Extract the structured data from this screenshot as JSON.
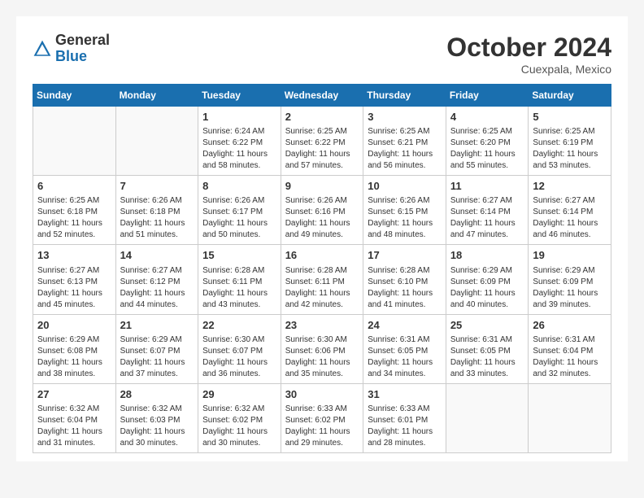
{
  "header": {
    "logo_line1": "General",
    "logo_line2": "Blue",
    "title": "October 2024",
    "subtitle": "Cuexpala, Mexico"
  },
  "days_of_week": [
    "Sunday",
    "Monday",
    "Tuesday",
    "Wednesday",
    "Thursday",
    "Friday",
    "Saturday"
  ],
  "weeks": [
    [
      {
        "day": "",
        "info": ""
      },
      {
        "day": "",
        "info": ""
      },
      {
        "day": "1",
        "info": "Sunrise: 6:24 AM\nSunset: 6:22 PM\nDaylight: 11 hours and 58 minutes."
      },
      {
        "day": "2",
        "info": "Sunrise: 6:25 AM\nSunset: 6:22 PM\nDaylight: 11 hours and 57 minutes."
      },
      {
        "day": "3",
        "info": "Sunrise: 6:25 AM\nSunset: 6:21 PM\nDaylight: 11 hours and 56 minutes."
      },
      {
        "day": "4",
        "info": "Sunrise: 6:25 AM\nSunset: 6:20 PM\nDaylight: 11 hours and 55 minutes."
      },
      {
        "day": "5",
        "info": "Sunrise: 6:25 AM\nSunset: 6:19 PM\nDaylight: 11 hours and 53 minutes."
      }
    ],
    [
      {
        "day": "6",
        "info": "Sunrise: 6:25 AM\nSunset: 6:18 PM\nDaylight: 11 hours and 52 minutes."
      },
      {
        "day": "7",
        "info": "Sunrise: 6:26 AM\nSunset: 6:18 PM\nDaylight: 11 hours and 51 minutes."
      },
      {
        "day": "8",
        "info": "Sunrise: 6:26 AM\nSunset: 6:17 PM\nDaylight: 11 hours and 50 minutes."
      },
      {
        "day": "9",
        "info": "Sunrise: 6:26 AM\nSunset: 6:16 PM\nDaylight: 11 hours and 49 minutes."
      },
      {
        "day": "10",
        "info": "Sunrise: 6:26 AM\nSunset: 6:15 PM\nDaylight: 11 hours and 48 minutes."
      },
      {
        "day": "11",
        "info": "Sunrise: 6:27 AM\nSunset: 6:14 PM\nDaylight: 11 hours and 47 minutes."
      },
      {
        "day": "12",
        "info": "Sunrise: 6:27 AM\nSunset: 6:14 PM\nDaylight: 11 hours and 46 minutes."
      }
    ],
    [
      {
        "day": "13",
        "info": "Sunrise: 6:27 AM\nSunset: 6:13 PM\nDaylight: 11 hours and 45 minutes."
      },
      {
        "day": "14",
        "info": "Sunrise: 6:27 AM\nSunset: 6:12 PM\nDaylight: 11 hours and 44 minutes."
      },
      {
        "day": "15",
        "info": "Sunrise: 6:28 AM\nSunset: 6:11 PM\nDaylight: 11 hours and 43 minutes."
      },
      {
        "day": "16",
        "info": "Sunrise: 6:28 AM\nSunset: 6:11 PM\nDaylight: 11 hours and 42 minutes."
      },
      {
        "day": "17",
        "info": "Sunrise: 6:28 AM\nSunset: 6:10 PM\nDaylight: 11 hours and 41 minutes."
      },
      {
        "day": "18",
        "info": "Sunrise: 6:29 AM\nSunset: 6:09 PM\nDaylight: 11 hours and 40 minutes."
      },
      {
        "day": "19",
        "info": "Sunrise: 6:29 AM\nSunset: 6:09 PM\nDaylight: 11 hours and 39 minutes."
      }
    ],
    [
      {
        "day": "20",
        "info": "Sunrise: 6:29 AM\nSunset: 6:08 PM\nDaylight: 11 hours and 38 minutes."
      },
      {
        "day": "21",
        "info": "Sunrise: 6:29 AM\nSunset: 6:07 PM\nDaylight: 11 hours and 37 minutes."
      },
      {
        "day": "22",
        "info": "Sunrise: 6:30 AM\nSunset: 6:07 PM\nDaylight: 11 hours and 36 minutes."
      },
      {
        "day": "23",
        "info": "Sunrise: 6:30 AM\nSunset: 6:06 PM\nDaylight: 11 hours and 35 minutes."
      },
      {
        "day": "24",
        "info": "Sunrise: 6:31 AM\nSunset: 6:05 PM\nDaylight: 11 hours and 34 minutes."
      },
      {
        "day": "25",
        "info": "Sunrise: 6:31 AM\nSunset: 6:05 PM\nDaylight: 11 hours and 33 minutes."
      },
      {
        "day": "26",
        "info": "Sunrise: 6:31 AM\nSunset: 6:04 PM\nDaylight: 11 hours and 32 minutes."
      }
    ],
    [
      {
        "day": "27",
        "info": "Sunrise: 6:32 AM\nSunset: 6:04 PM\nDaylight: 11 hours and 31 minutes."
      },
      {
        "day": "28",
        "info": "Sunrise: 6:32 AM\nSunset: 6:03 PM\nDaylight: 11 hours and 30 minutes."
      },
      {
        "day": "29",
        "info": "Sunrise: 6:32 AM\nSunset: 6:02 PM\nDaylight: 11 hours and 30 minutes."
      },
      {
        "day": "30",
        "info": "Sunrise: 6:33 AM\nSunset: 6:02 PM\nDaylight: 11 hours and 29 minutes."
      },
      {
        "day": "31",
        "info": "Sunrise: 6:33 AM\nSunset: 6:01 PM\nDaylight: 11 hours and 28 minutes."
      },
      {
        "day": "",
        "info": ""
      },
      {
        "day": "",
        "info": ""
      }
    ]
  ]
}
